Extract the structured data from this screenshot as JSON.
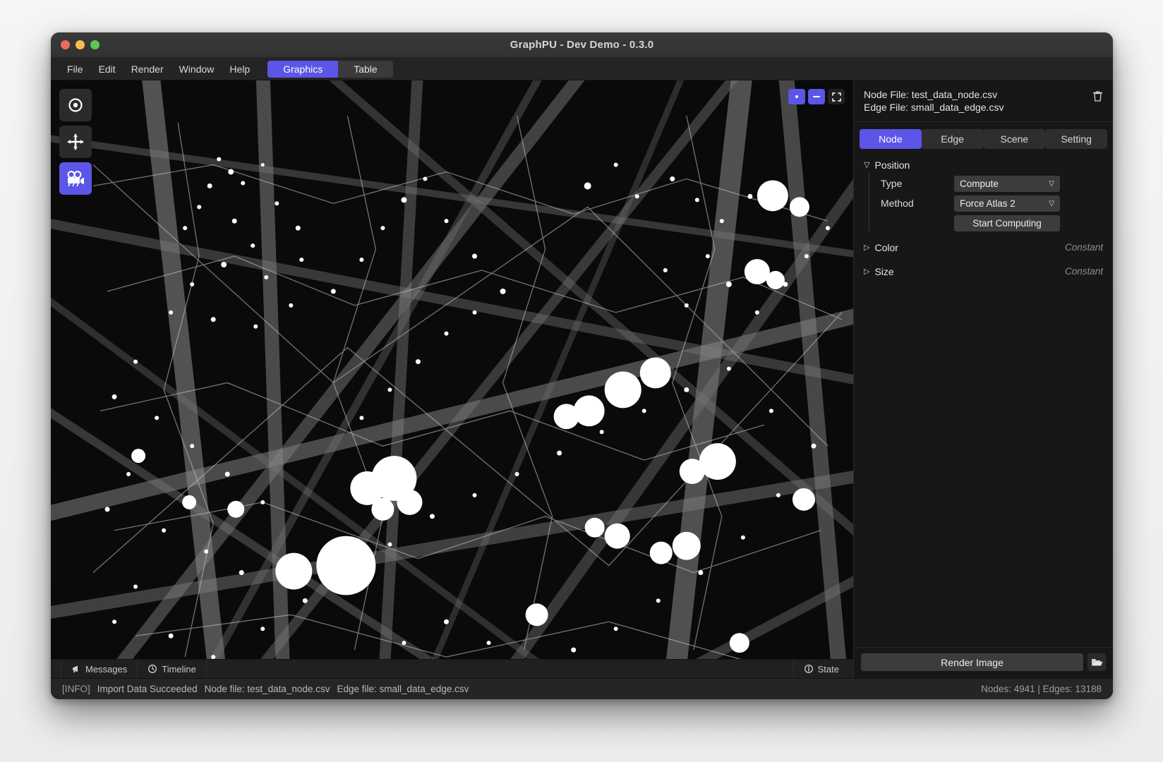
{
  "window": {
    "title": "GraphPU - Dev Demo - 0.3.0",
    "traffic": {
      "close": "close-button",
      "minimize": "minimize-button",
      "zoom": "zoom-button"
    }
  },
  "menubar": {
    "items": [
      {
        "label": "File"
      },
      {
        "label": "Edit"
      },
      {
        "label": "Render"
      },
      {
        "label": "Window"
      },
      {
        "label": "Help"
      }
    ],
    "modes": [
      {
        "label": "Graphics",
        "active": true
      },
      {
        "label": "Table",
        "active": false
      }
    ]
  },
  "viewport": {
    "tools": [
      {
        "name": "select-target-tool",
        "icon": "target-icon",
        "active": false
      },
      {
        "name": "move-tool",
        "icon": "move-cross-icon",
        "active": false
      },
      {
        "name": "camera-tool",
        "icon": "camera-icon",
        "active": true
      }
    ],
    "controls": [
      {
        "name": "point-view-button",
        "icon": "dot-icon",
        "accent": true
      },
      {
        "name": "line-view-button",
        "icon": "minus-icon",
        "accent": true
      },
      {
        "name": "fit-screen-button",
        "icon": "fullscreen-icon",
        "accent": false
      }
    ],
    "tabs": [
      {
        "label": "Messages",
        "icon": "megaphone-icon"
      },
      {
        "label": "Timeline",
        "icon": "clock-icon"
      }
    ],
    "state_tab": {
      "label": "State",
      "icon": "info-icon"
    }
  },
  "panel": {
    "node_file": "Node File: test_data_node.csv",
    "edge_file": "Edge File: small_data_edge.csv",
    "delete_icon": "trash-icon",
    "tabs": [
      {
        "label": "Node",
        "active": true
      },
      {
        "label": "Edge",
        "active": false
      },
      {
        "label": "Scene",
        "active": false
      },
      {
        "label": "Setting",
        "active": false
      }
    ],
    "position": {
      "title": "Position",
      "caret": "▽",
      "type_label": "Type",
      "type_value": "Compute",
      "method_label": "Method",
      "method_value": "Force Atlas 2",
      "start_button": "Start Computing"
    },
    "color": {
      "title": "Color",
      "caret": "▷",
      "value": "Constant"
    },
    "size": {
      "title": "Size",
      "caret": "▷",
      "value": "Constant"
    },
    "footer": {
      "render_label": "Render Image",
      "folder_icon": "folder-open-icon"
    }
  },
  "statusbar": {
    "tag": "[INFO]",
    "message": "Import Data Succeeded",
    "node_file": "Node file: test_data_node.csv",
    "edge_file": "Edge file: small_data_edge.csv",
    "counts": "Nodes: 4941  |  Edges: 13188"
  },
  "theme": {
    "accent": "#5b55e8",
    "window_bg": "#1b1b1b",
    "viewport_bg": "#0a0a0a",
    "panel_bg": "#171717",
    "node_color": "#ffffff",
    "edge_color": "#b0b0b0"
  }
}
